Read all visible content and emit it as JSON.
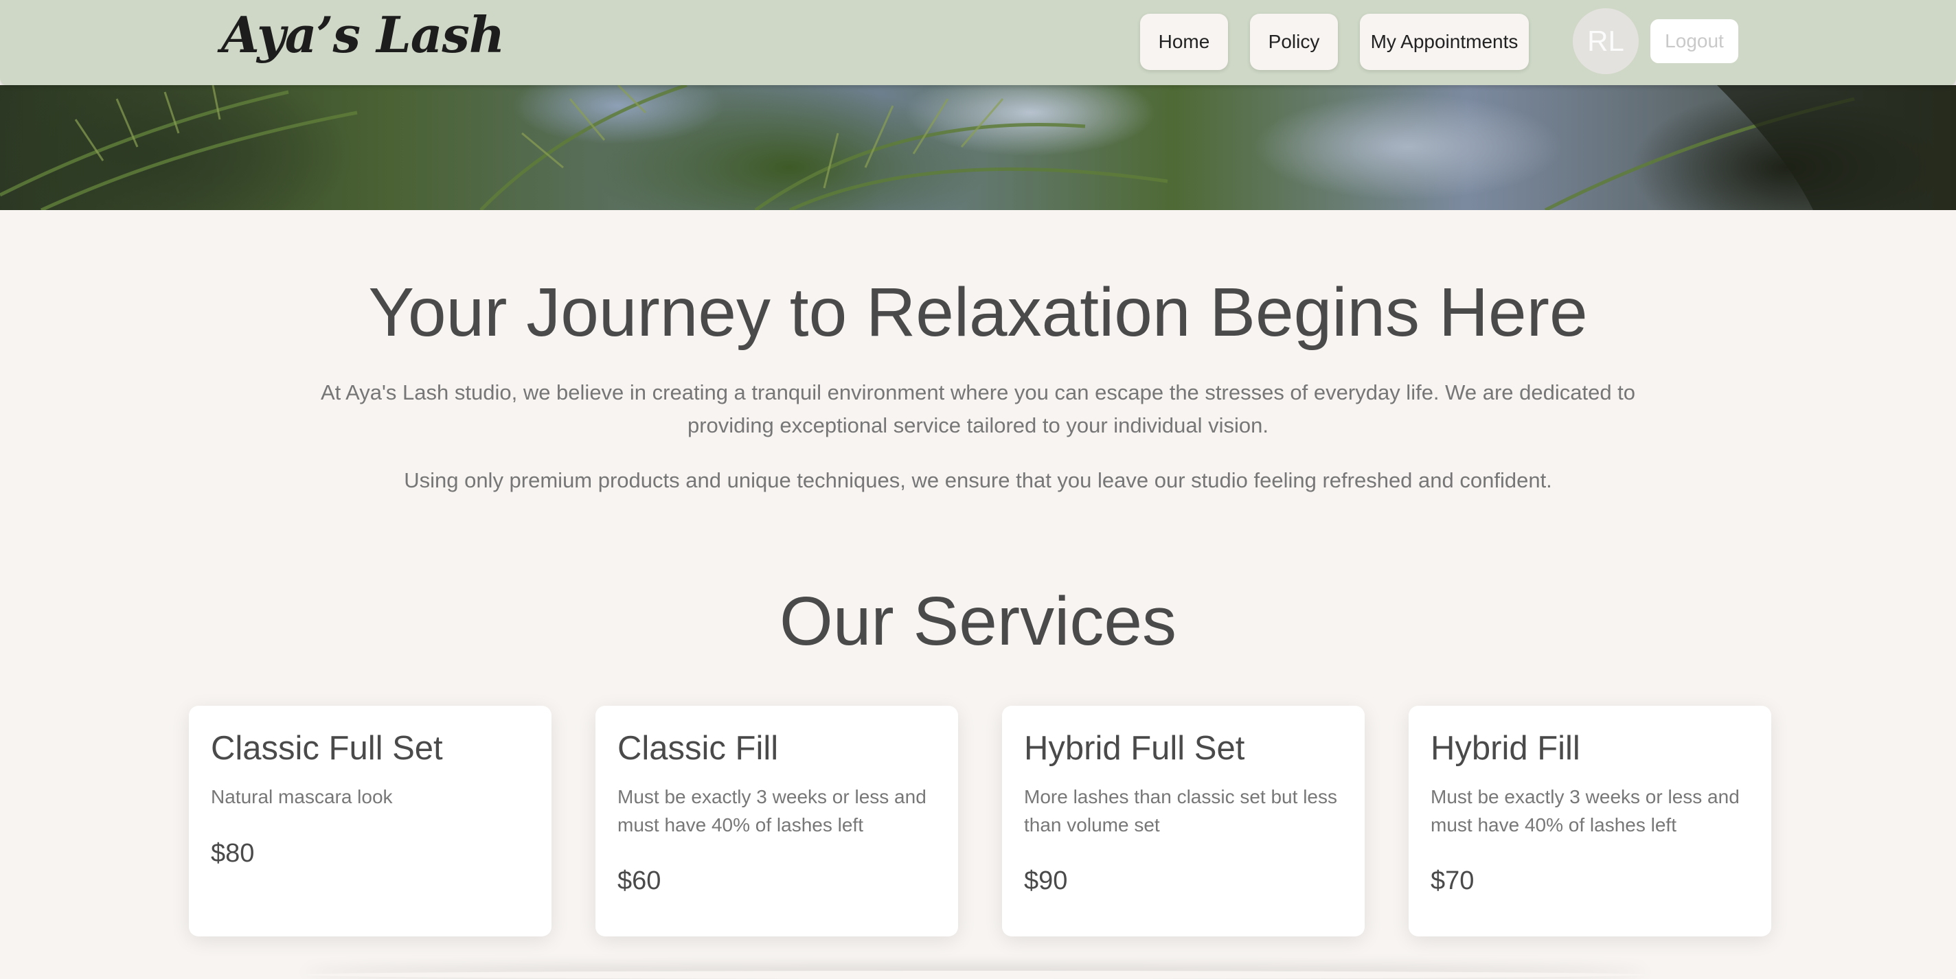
{
  "brand": {
    "name": "Aya’s Lash"
  },
  "nav": {
    "home": "Home",
    "policy": "Policy",
    "appointments": "My Appointments",
    "avatar_initials": "RL",
    "logout": "Logout"
  },
  "hero": {
    "image": "palm-canopy-sky-banner"
  },
  "intro": {
    "heading": "Your Journey to Relaxation Begins Here",
    "paragraph1": "At Aya's Lash studio, we believe in creating a tranquil environment where you can escape the stresses of everyday life. We are dedicated to providing exceptional service tailored to your individual vision.",
    "paragraph2": "Using only premium products and unique techniques, we ensure that you leave our studio feeling refreshed and confident."
  },
  "services": {
    "heading": "Our Services",
    "items": [
      {
        "title": "Classic Full Set",
        "description": "Natural mascara look",
        "price": "$80"
      },
      {
        "title": "Classic Fill",
        "description": "Must be exactly 3 weeks or less and must have 40% of lashes left",
        "price": "$60"
      },
      {
        "title": "Hybrid Full Set",
        "description": "More lashes than classic set but less than volume set",
        "price": "$90"
      },
      {
        "title": "Hybrid Fill",
        "description": "Must be exactly 3 weeks or less and must have 40% of lashes left",
        "price": "$70"
      }
    ]
  },
  "colors": {
    "navbar": "#cfd8c6",
    "page_background": "#f7f4f1",
    "heading_text": "#4a4a4a",
    "body_text": "#767676"
  }
}
